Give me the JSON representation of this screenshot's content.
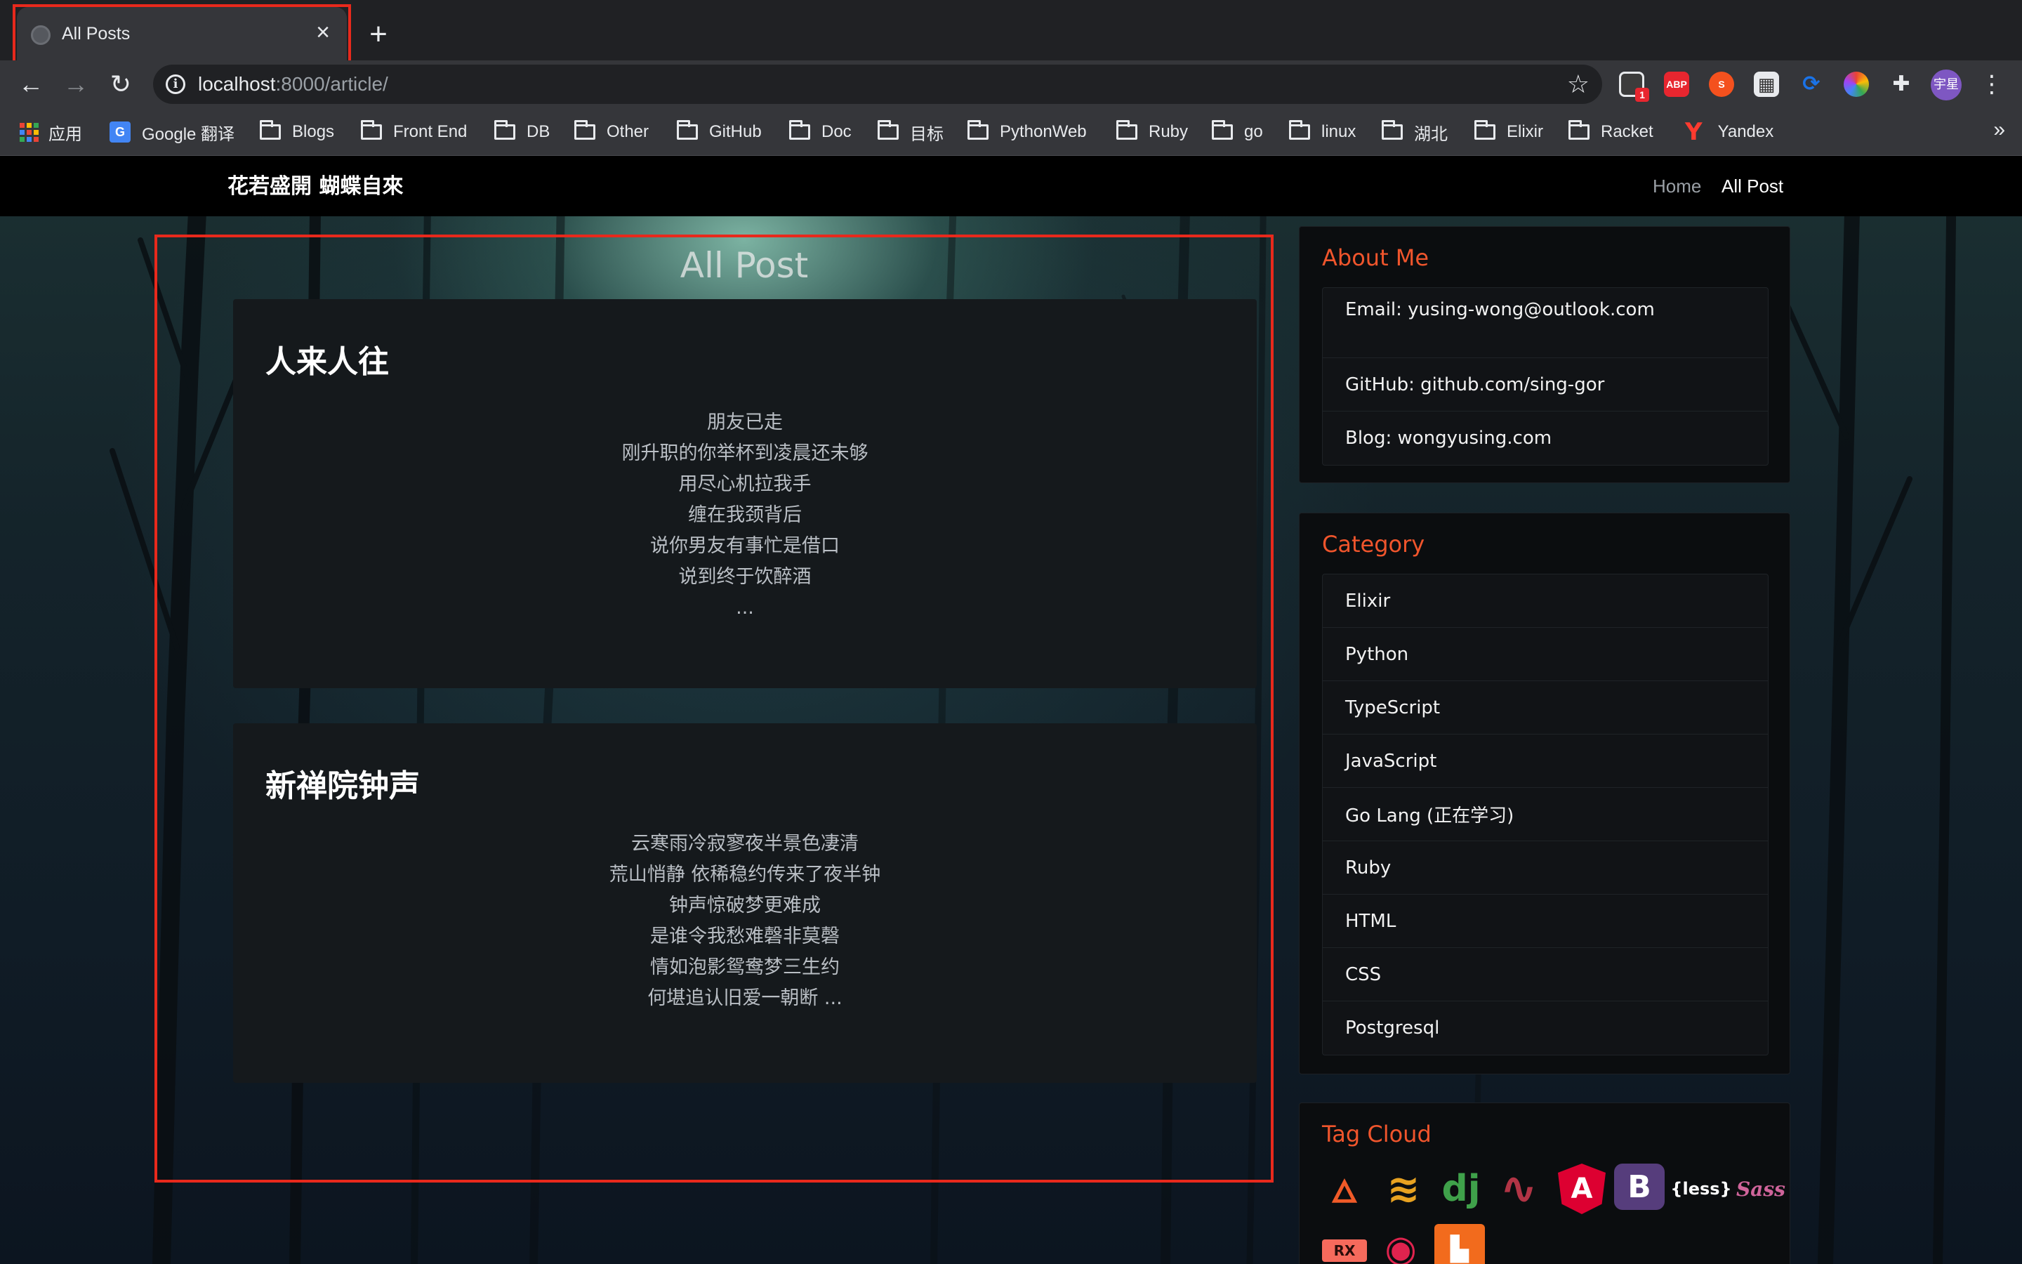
{
  "browser": {
    "tab": {
      "title": "All Posts"
    },
    "url": {
      "host": "localhost",
      "rest": ":8000/article/"
    },
    "avatar_text": "宇星",
    "bookmarks": [
      {
        "label": "应用",
        "icon": "apps-icon"
      },
      {
        "label": "Google 翻译",
        "icon": "google-translate-icon"
      },
      {
        "label": "Blogs",
        "icon": "folder-icon"
      },
      {
        "label": "Front End",
        "icon": "folder-icon"
      },
      {
        "label": "DB",
        "icon": "folder-icon"
      },
      {
        "label": "Other",
        "icon": "folder-icon"
      },
      {
        "label": "GitHub",
        "icon": "folder-icon"
      },
      {
        "label": "Doc",
        "icon": "folder-icon"
      },
      {
        "label": "目标",
        "icon": "folder-icon"
      },
      {
        "label": "PythonWeb",
        "icon": "folder-icon"
      },
      {
        "label": "Ruby",
        "icon": "folder-icon"
      },
      {
        "label": "go",
        "icon": "folder-icon"
      },
      {
        "label": "linux",
        "icon": "folder-icon"
      },
      {
        "label": "湖北",
        "icon": "folder-icon"
      },
      {
        "label": "Elixir",
        "icon": "folder-icon"
      },
      {
        "label": "Racket",
        "icon": "folder-icon"
      },
      {
        "label": "Yandex",
        "icon": "yandex-icon"
      }
    ],
    "extensions": [
      {
        "name": "screen-capture-extension-icon",
        "text": "",
        "badge": "1",
        "color": "#3c3c3c"
      },
      {
        "name": "adblock-plus-icon",
        "text": "ABP",
        "color": "#e8262f"
      },
      {
        "name": "s-extension-icon",
        "text": "S",
        "color": "#f4511e"
      },
      {
        "name": "qr-extension-icon",
        "text": "",
        "color": "#e8eaed"
      },
      {
        "name": "crop-extension-icon",
        "text": "",
        "color": "#1a73e8"
      },
      {
        "name": "color-picker-extension-icon",
        "text": "",
        "color": "#34a853"
      },
      {
        "name": "extensions-puzzle-icon",
        "text": "",
        "color": "#e8eaed"
      }
    ]
  },
  "site": {
    "brand": "花若盛開 蝴蝶自來",
    "nav": {
      "home": "Home",
      "all": "All Post"
    },
    "heading": "All Post",
    "posts": [
      {
        "title": "人来人往",
        "lines": [
          "朋友已走",
          "刚升职的你举杯到凌晨还未够",
          "用尽心机拉我手",
          "缠在我颈背后",
          "说你男友有事忙是借口",
          "说到终于饮醉酒",
          "..."
        ]
      },
      {
        "title": "新禅院钟声",
        "lines": [
          "云寒雨冷寂寥夜半景色凄清",
          "荒山悄静 依稀稳约传来了夜半钟",
          "钟声惊破梦更难成",
          "是谁令我愁难磬非莫磬",
          "情如泡影鸳鸯梦三生约",
          "何堪追认旧爱一朝断 ..."
        ]
      }
    ],
    "about": {
      "title": "About Me",
      "items": [
        "Email: yusing-wong@outlook.com",
        "GitHub: github.com/sing-gor",
        "Blog: wongyusing.com"
      ]
    },
    "category": {
      "title": "Category",
      "items": [
        "Elixir",
        "Python",
        "TypeScript",
        "JavaScript",
        "Go Lang (正在学习)",
        "Ruby",
        "HTML",
        "CSS",
        "Postgresql"
      ]
    },
    "tag_cloud": {
      "title": "Tag Cloud",
      "tags": [
        {
          "name": "phoenix-icon",
          "text": "",
          "color": "#f05a28"
        },
        {
          "name": "tornado-icon",
          "text": "",
          "color": "#e8a221"
        },
        {
          "name": "django-icon",
          "text": "dj",
          "color": "#3fa14a"
        },
        {
          "name": "rails-icon",
          "text": "",
          "color": "#b23445"
        },
        {
          "name": "angular-icon",
          "text": "A",
          "color": "#dd0031"
        },
        {
          "name": "bootstrap-icon",
          "text": "B",
          "color": "#563d7c"
        },
        {
          "name": "less-icon",
          "text": "{less}",
          "color": "#ffffff"
        },
        {
          "name": "sass-icon",
          "text": "Sass",
          "color": "#cf649a"
        },
        {
          "name": "rx-icon",
          "text": "RX",
          "color": "#f66a5c"
        },
        {
          "name": "nestjs-icon",
          "text": "",
          "color": "#e0234e"
        },
        {
          "name": "rabbitmq-icon",
          "text": "",
          "color": "#f26b1d"
        }
      ]
    }
  }
}
